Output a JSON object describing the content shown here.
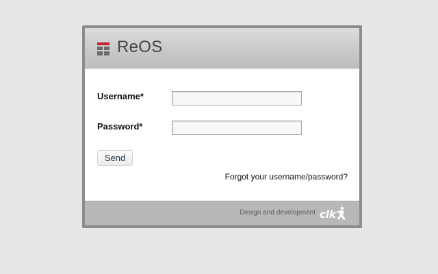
{
  "header": {
    "app_name": "ReOS",
    "logo_icon": "reos-logo-icon"
  },
  "form": {
    "username_label": "Username*",
    "username_value": "",
    "password_label": "Password*",
    "password_value": "",
    "send_label": "Send",
    "forgot_link": "Forgot your username/password?"
  },
  "footer": {
    "credit_text": "Design and development",
    "company_logo_text": "clk"
  },
  "colors": {
    "page_background": "#e7e7e8",
    "panel_border": "#8c8c8c",
    "header_background": "#c9c9c9",
    "footer_background": "#b8b8b8",
    "logo_red": "#c8202e"
  }
}
